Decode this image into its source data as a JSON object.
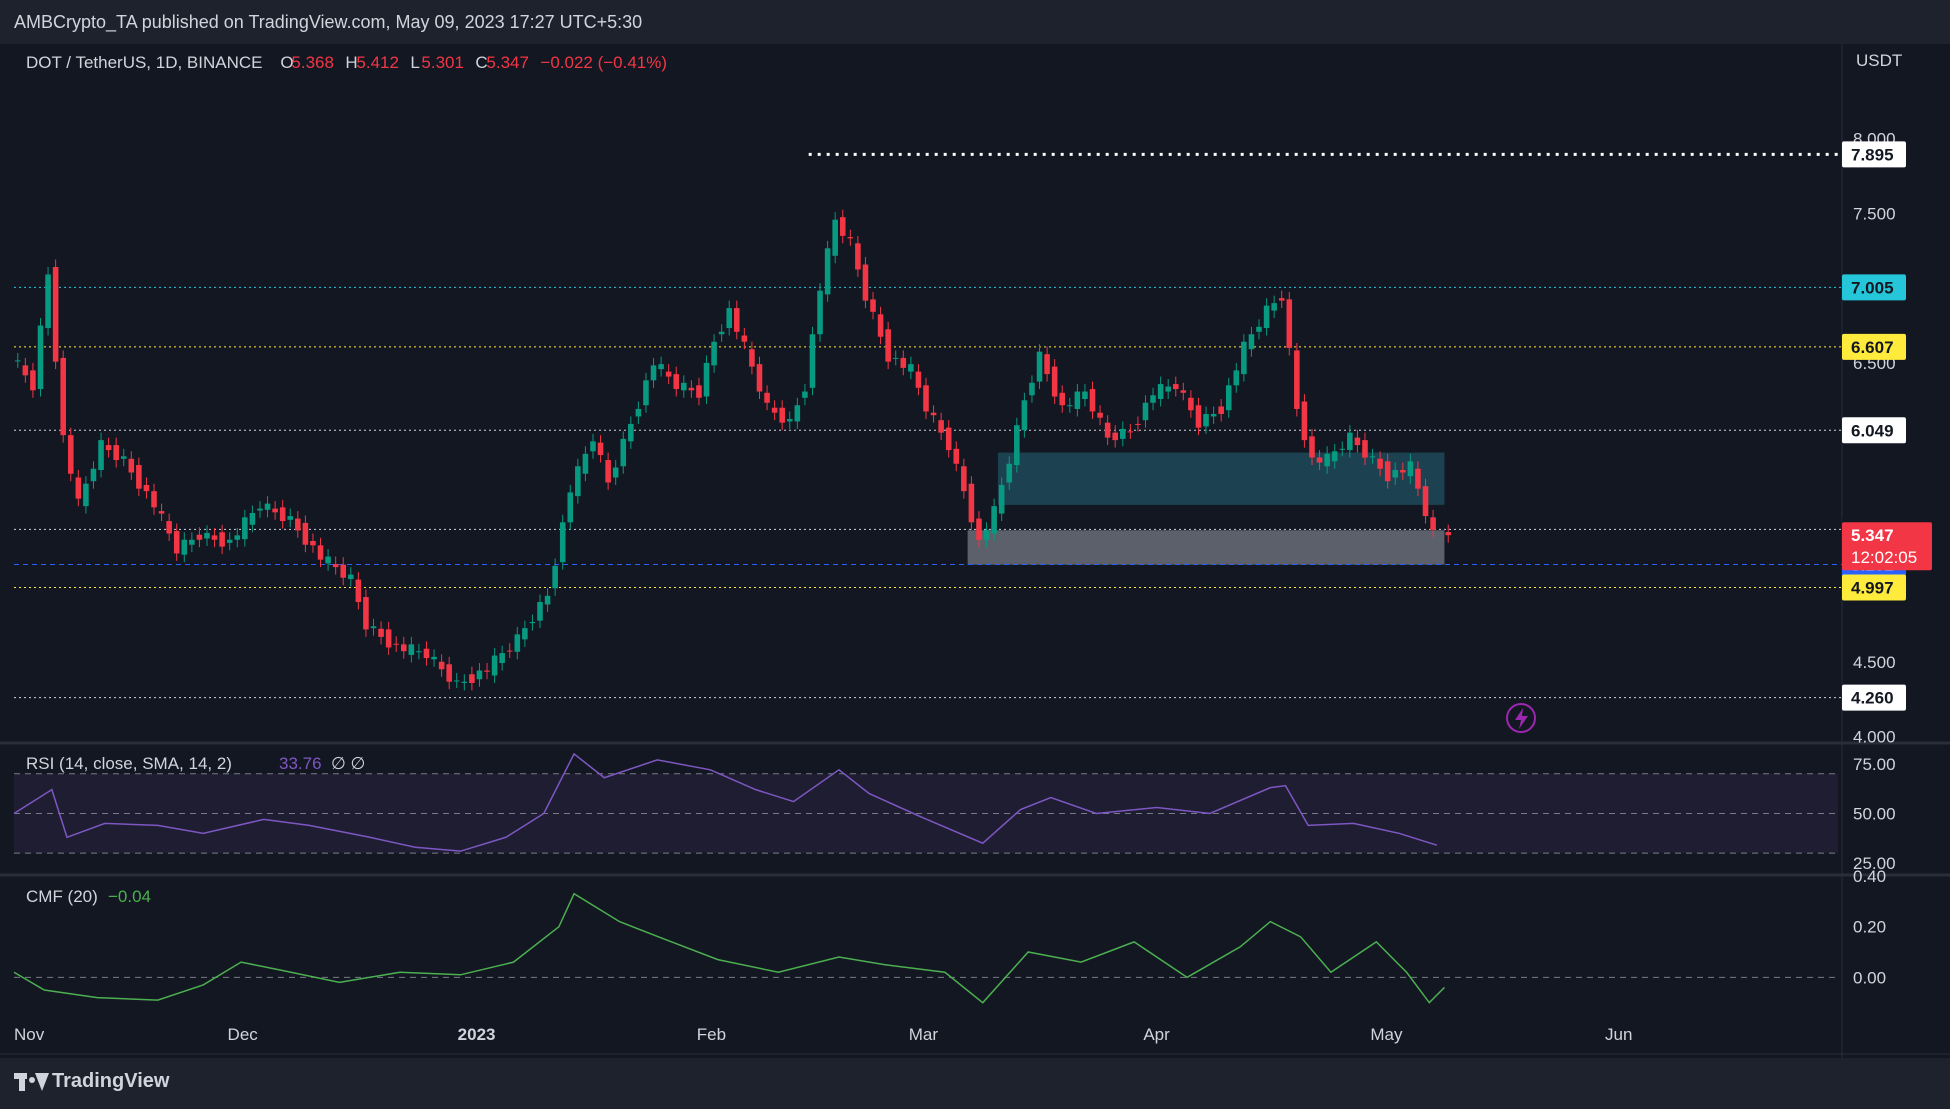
{
  "header": {
    "published_text": "AMBCrypto_TA published on TradingView.com, May 09, 2023 17:27 UTC+5:30"
  },
  "footer": {
    "brand": "TradingView"
  },
  "chart_data": [
    {
      "type": "candlestick",
      "symbol": "DOT / TetherUS, 1D, BINANCE",
      "ohlc": {
        "o_label": "O",
        "o_value": "5.368",
        "h_label": "H",
        "h_value": "5.412",
        "l_label": "L",
        "l_value": "5.301",
        "c_label": "C",
        "c_value": "5.347",
        "change": "−0.022 (−0.41%)"
      },
      "currency": "USDT",
      "y_ticks": [
        "4.000",
        "4.500",
        "5.000",
        "6.500",
        "7.500",
        "8.000"
      ],
      "ylim": [
        3.97,
        8.5
      ],
      "x_ticks": [
        "Nov",
        "Dec",
        "2023",
        "Feb",
        "Mar",
        "Apr",
        "May",
        "Jun"
      ],
      "x_range": [
        "2022-11-01",
        "2023-06-30"
      ],
      "closes": [
        {
          "date": "2022-11-01",
          "close": 6.55
        },
        {
          "date": "2022-11-04",
          "close": 6.35
        },
        {
          "date": "2022-11-06",
          "close": 7.1
        },
        {
          "date": "2022-11-08",
          "close": 6.0
        },
        {
          "date": "2022-11-10",
          "close": 5.55
        },
        {
          "date": "2022-11-13",
          "close": 5.95
        },
        {
          "date": "2022-11-16",
          "close": 5.85
        },
        {
          "date": "2022-11-20",
          "close": 5.55
        },
        {
          "date": "2022-11-23",
          "close": 5.25
        },
        {
          "date": "2022-11-26",
          "close": 5.35
        },
        {
          "date": "2022-11-30",
          "close": 5.3
        },
        {
          "date": "2022-12-04",
          "close": 5.55
        },
        {
          "date": "2022-12-08",
          "close": 5.45
        },
        {
          "date": "2022-12-12",
          "close": 5.2
        },
        {
          "date": "2022-12-16",
          "close": 5.05
        },
        {
          "date": "2022-12-18",
          "close": 4.75
        },
        {
          "date": "2022-12-22",
          "close": 4.6
        },
        {
          "date": "2022-12-26",
          "close": 4.55
        },
        {
          "date": "2022-12-30",
          "close": 4.35
        },
        {
          "date": "2023-01-03",
          "close": 4.45
        },
        {
          "date": "2023-01-07",
          "close": 4.65
        },
        {
          "date": "2023-01-11",
          "close": 4.95
        },
        {
          "date": "2023-01-14",
          "close": 5.65
        },
        {
          "date": "2023-01-17",
          "close": 6.0
        },
        {
          "date": "2023-01-19",
          "close": 5.7
        },
        {
          "date": "2023-01-22",
          "close": 6.1
        },
        {
          "date": "2023-01-25",
          "close": 6.5
        },
        {
          "date": "2023-01-28",
          "close": 6.35
        },
        {
          "date": "2023-01-31",
          "close": 6.3
        },
        {
          "date": "2023-02-02",
          "close": 6.65
        },
        {
          "date": "2023-02-04",
          "close": 6.85
        },
        {
          "date": "2023-02-06",
          "close": 6.6
        },
        {
          "date": "2023-02-09",
          "close": 6.2
        },
        {
          "date": "2023-02-12",
          "close": 6.1
        },
        {
          "date": "2023-02-14",
          "close": 6.35
        },
        {
          "date": "2023-02-16",
          "close": 7.0
        },
        {
          "date": "2023-02-18",
          "close": 7.45
        },
        {
          "date": "2023-02-20",
          "close": 7.3
        },
        {
          "date": "2023-02-22",
          "close": 6.95
        },
        {
          "date": "2023-02-25",
          "close": 6.55
        },
        {
          "date": "2023-02-28",
          "close": 6.45
        },
        {
          "date": "2023-03-02",
          "close": 6.2
        },
        {
          "date": "2023-03-05",
          "close": 5.95
        },
        {
          "date": "2023-03-07",
          "close": 5.65
        },
        {
          "date": "2023-03-09",
          "close": 5.3
        },
        {
          "date": "2023-03-11",
          "close": 5.5
        },
        {
          "date": "2023-03-13",
          "close": 5.85
        },
        {
          "date": "2023-03-15",
          "close": 6.25
        },
        {
          "date": "2023-03-17",
          "close": 6.55
        },
        {
          "date": "2023-03-20",
          "close": 6.2
        },
        {
          "date": "2023-03-23",
          "close": 6.3
        },
        {
          "date": "2023-03-26",
          "close": 6.0
        },
        {
          "date": "2023-03-29",
          "close": 6.05
        },
        {
          "date": "2023-04-01",
          "close": 6.3
        },
        {
          "date": "2023-04-04",
          "close": 6.35
        },
        {
          "date": "2023-04-07",
          "close": 6.1
        },
        {
          "date": "2023-04-10",
          "close": 6.2
        },
        {
          "date": "2023-04-13",
          "close": 6.6
        },
        {
          "date": "2023-04-16",
          "close": 6.85
        },
        {
          "date": "2023-04-18",
          "close": 6.95
        },
        {
          "date": "2023-04-20",
          "close": 6.2
        },
        {
          "date": "2023-04-22",
          "close": 5.85
        },
        {
          "date": "2023-04-24",
          "close": 5.85
        },
        {
          "date": "2023-04-27",
          "close": 6.0
        },
        {
          "date": "2023-04-29",
          "close": 5.9
        },
        {
          "date": "2023-05-02",
          "close": 5.75
        },
        {
          "date": "2023-05-05",
          "close": 5.8
        },
        {
          "date": "2023-05-08",
          "close": 5.35
        }
      ],
      "last_close": 5.347,
      "horizontal_levels": [
        {
          "value": 7.895,
          "label": "7.895",
          "style": "dotted",
          "line_color": "#ffffff",
          "label_bg": "#ffffff",
          "label_fg": "#131722"
        },
        {
          "value": 7.005,
          "label": "7.005",
          "style": "dotted",
          "line_color": "#26c6da",
          "label_bg": "#26c6da",
          "label_fg": "#131722"
        },
        {
          "value": 6.607,
          "label": "6.607",
          "style": "dotted",
          "line_color": "#ffeb3b",
          "label_bg": "#ffeb3b",
          "label_fg": "#131722"
        },
        {
          "value": 6.049,
          "label": "6.049",
          "style": "dotted",
          "line_color": "#d1d4dc",
          "label_bg": "#ffffff",
          "label_fg": "#131722"
        },
        {
          "value": 5.386,
          "label": "5.386",
          "style": "dotted",
          "line_color": "#d1d4dc",
          "label_bg": "#131722",
          "label_fg": "#ffffff"
        },
        {
          "value": 5.151,
          "label": "5.151",
          "style": "dashed",
          "line_color": "#2962ff",
          "label_bg": "#2962ff",
          "label_fg": "#ffffff"
        },
        {
          "value": 4.997,
          "label": "4.997",
          "style": "dotted",
          "line_color": "#ffeb3b",
          "label_bg": "#ffeb3b",
          "label_fg": "#131722"
        },
        {
          "value": 4.26,
          "label": "4.260",
          "style": "dotted",
          "line_color": "#d1d4dc",
          "label_bg": "#ffffff",
          "label_fg": "#131722"
        }
      ],
      "last_price_label": {
        "price": "5.347",
        "countdown": "12:02:05",
        "bg": "#f23645"
      },
      "zones": [
        {
          "from_date": "2023-03-11",
          "to_date": "2023-05-09",
          "y_low": 5.55,
          "y_high": 5.9,
          "color": "#1e4a5a"
        },
        {
          "from_date": "2023-03-07",
          "to_date": "2023-05-09",
          "y_low": 5.15,
          "y_high": 5.38,
          "color": "#6a6d78"
        }
      ],
      "colors": {
        "up": "#089981",
        "down": "#f23645",
        "background": "#131722"
      }
    },
    {
      "type": "line",
      "title": "RSI (14, close, SMA, 14, 2)",
      "value": "33.76",
      "extra": "∅ ∅",
      "y_ticks": [
        "25.00",
        "50.00",
        "75.00"
      ],
      "ylim": [
        20,
        85
      ],
      "band": [
        30,
        70
      ],
      "color": "#7e57c2",
      "series": [
        {
          "date": "2022-11-01",
          "value": 50
        },
        {
          "date": "2022-11-06",
          "value": 62
        },
        {
          "date": "2022-11-08",
          "value": 38
        },
        {
          "date": "2022-11-13",
          "value": 45
        },
        {
          "date": "2022-11-20",
          "value": 44
        },
        {
          "date": "2022-11-26",
          "value": 40
        },
        {
          "date": "2022-12-04",
          "value": 47
        },
        {
          "date": "2022-12-10",
          "value": 44
        },
        {
          "date": "2022-12-18",
          "value": 38
        },
        {
          "date": "2022-12-24",
          "value": 33
        },
        {
          "date": "2022-12-30",
          "value": 31
        },
        {
          "date": "2023-01-05",
          "value": 38
        },
        {
          "date": "2023-01-10",
          "value": 50
        },
        {
          "date": "2023-01-14",
          "value": 80
        },
        {
          "date": "2023-01-18",
          "value": 68
        },
        {
          "date": "2023-01-25",
          "value": 77
        },
        {
          "date": "2023-02-01",
          "value": 72
        },
        {
          "date": "2023-02-07",
          "value": 62
        },
        {
          "date": "2023-02-12",
          "value": 56
        },
        {
          "date": "2023-02-18",
          "value": 72
        },
        {
          "date": "2023-02-22",
          "value": 60
        },
        {
          "date": "2023-03-01",
          "value": 48
        },
        {
          "date": "2023-03-09",
          "value": 35
        },
        {
          "date": "2023-03-14",
          "value": 52
        },
        {
          "date": "2023-03-18",
          "value": 58
        },
        {
          "date": "2023-03-24",
          "value": 50
        },
        {
          "date": "2023-04-01",
          "value": 53
        },
        {
          "date": "2023-04-08",
          "value": 50
        },
        {
          "date": "2023-04-16",
          "value": 63
        },
        {
          "date": "2023-04-18",
          "value": 64
        },
        {
          "date": "2023-04-21",
          "value": 44
        },
        {
          "date": "2023-04-27",
          "value": 45
        },
        {
          "date": "2023-05-03",
          "value": 40
        },
        {
          "date": "2023-05-08",
          "value": 34
        }
      ]
    },
    {
      "type": "line",
      "title": "CMF (20)",
      "value": "−0.04",
      "y_ticks": [
        "0.00",
        "0.20",
        "0.40"
      ],
      "ylim": [
        -0.2,
        0.4
      ],
      "color": "#4caf50",
      "series": [
        {
          "date": "2022-11-01",
          "value": 0.02
        },
        {
          "date": "2022-11-05",
          "value": -0.05
        },
        {
          "date": "2022-11-12",
          "value": -0.08
        },
        {
          "date": "2022-11-20",
          "value": -0.09
        },
        {
          "date": "2022-11-26",
          "value": -0.03
        },
        {
          "date": "2022-12-01",
          "value": 0.06
        },
        {
          "date": "2022-12-06",
          "value": 0.03
        },
        {
          "date": "2022-12-14",
          "value": -0.02
        },
        {
          "date": "2022-12-22",
          "value": 0.02
        },
        {
          "date": "2022-12-30",
          "value": 0.01
        },
        {
          "date": "2023-01-06",
          "value": 0.06
        },
        {
          "date": "2023-01-12",
          "value": 0.2
        },
        {
          "date": "2023-01-14",
          "value": 0.33
        },
        {
          "date": "2023-01-20",
          "value": 0.22
        },
        {
          "date": "2023-01-26",
          "value": 0.15
        },
        {
          "date": "2023-02-02",
          "value": 0.07
        },
        {
          "date": "2023-02-10",
          "value": 0.02
        },
        {
          "date": "2023-02-18",
          "value": 0.08
        },
        {
          "date": "2023-02-24",
          "value": 0.05
        },
        {
          "date": "2023-03-04",
          "value": 0.02
        },
        {
          "date": "2023-03-09",
          "value": -0.1
        },
        {
          "date": "2023-03-15",
          "value": 0.1
        },
        {
          "date": "2023-03-22",
          "value": 0.06
        },
        {
          "date": "2023-03-29",
          "value": 0.14
        },
        {
          "date": "2023-04-05",
          "value": 0.0
        },
        {
          "date": "2023-04-12",
          "value": 0.12
        },
        {
          "date": "2023-04-16",
          "value": 0.22
        },
        {
          "date": "2023-04-20",
          "value": 0.16
        },
        {
          "date": "2023-04-24",
          "value": 0.02
        },
        {
          "date": "2023-04-30",
          "value": 0.14
        },
        {
          "date": "2023-05-04",
          "value": 0.02
        },
        {
          "date": "2023-05-07",
          "value": -0.1
        },
        {
          "date": "2023-05-09",
          "value": -0.04
        }
      ]
    }
  ]
}
